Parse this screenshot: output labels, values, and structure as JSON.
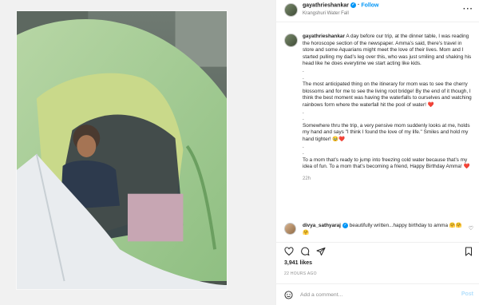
{
  "header": {
    "username": "gayathrieshankar",
    "verified_icon": "verified-badge-icon",
    "follow_label": "Follow",
    "location": "Krangshuri Water Fall",
    "more_icon": "more-horizontal-icon"
  },
  "caption": {
    "username": "gayathrieshankar",
    "paragraphs": [
      "A day before our trip, at the dinner table, I was reading the horoscope section of the newspaper. Amma’s said, there’s travel in store and some Aquarians might meet the love of their lives. Mom and I started pulling my dad’s leg over this, who was just smiling and shaking his head like he does everytime we start acting like kids.\n.\n.",
      "The most anticipated thing on the itinerary for mom was to see the cherry blossoms and for me to see the living root bridge! By the end of it though, I think the best moment was having the waterfalls to ourselves and watching rainbows form where the waterfall hit the pool of water! ❤️\n.\n.",
      "Somewhere thru the trip, a very pensive mom suddenly looks at me, holds my hand and says \"I think I found the love of my life.\" Smiles and hold my hand tighter! 🥹❤️\n.\n.",
      "To a mom that’s ready to jump into freezing cold water because that’s my idea of fun. To a mom that’s becoming a friend, Happy Birthday Amma! ❤️"
    ],
    "time": "22h"
  },
  "comment": {
    "username": "divya_sathyaraj",
    "text": "beautifully written...happy birthday to amma 🤗🤗🤗",
    "like_icon": "heart-outline-icon"
  },
  "actions": {
    "like_icon": "heart-outline-icon",
    "comment_icon": "comment-bubble-icon",
    "share_icon": "paper-plane-icon",
    "save_icon": "bookmark-icon"
  },
  "likes": "3,941 likes",
  "timestamp": "22 HOURS AGO",
  "add_comment": {
    "placeholder": "Add a comment...",
    "post_label": "Post",
    "emoji_icon": "smiley-icon"
  },
  "colors": {
    "accent": "#0095f6",
    "heart": "#ed4956",
    "post_disabled": "#b2dffc"
  }
}
